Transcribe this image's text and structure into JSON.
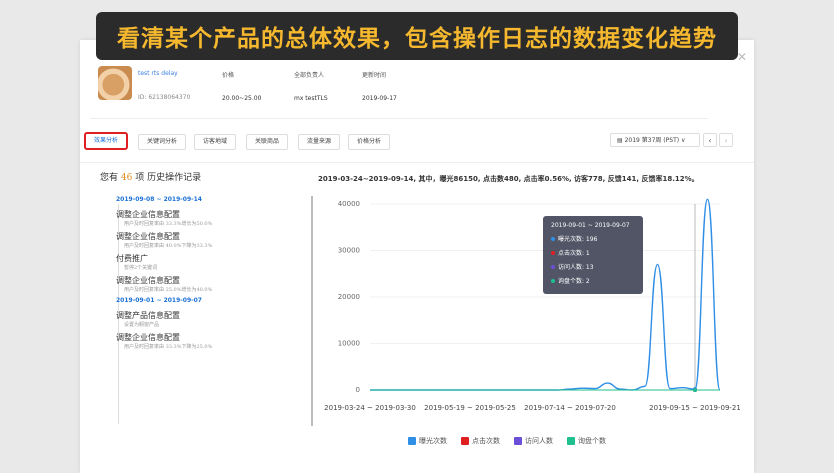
{
  "banner": "看清某个产品的总体效果，包含操作日志的数据变化趋势",
  "product": {
    "name": "test rts delay",
    "id": "ID: 62138064370",
    "price_label": "价格",
    "price": "20.00~25.00",
    "owner_label": "全部负责人",
    "owner": "mx testTLS",
    "updated_label": "更新时间",
    "updated": "2019-09-17"
  },
  "tabs": [
    "效果分析",
    "关键词分析",
    "访客地域",
    "关联商品",
    "流量来源",
    "价格分析"
  ],
  "week": "2019 第37周 (PST)",
  "log": {
    "title_pre": "您有",
    "count": "46",
    "title_post": "项 历史操作记录",
    "entries": [
      {
        "kind": "date",
        "text": "2019-09-08 ~ 2019-09-14"
      },
      {
        "kind": "op",
        "text": "调整企业信息配置",
        "sub": "用户及时回复率由 33.3%增长为50.0%"
      },
      {
        "kind": "op",
        "text": "调整企业信息配置",
        "sub": "用户及时回复率由 40.0%下降为33.3%"
      },
      {
        "kind": "op",
        "text": "付费推广",
        "sub": "暂停2个关键词"
      },
      {
        "kind": "op",
        "text": "调整企业信息配置",
        "sub": "用户及时回复率由 25.0%增长为40.0%"
      },
      {
        "kind": "date",
        "text": "2019-09-01 ~ 2019-09-07"
      },
      {
        "kind": "op",
        "text": "调整产品信息配置",
        "sub": "设置为橱窗产品"
      },
      {
        "kind": "op",
        "text": "调整企业信息配置",
        "sub": "用户及时回复率由 33.3%下降为25.0%"
      }
    ]
  },
  "summary": "2019-03-24~2019-09-14, 其中，曝光86150, 点击数480, 点击率0.56%, 访客778, 反馈141, 反馈率18.12%。",
  "tooltip": {
    "title": "2019-09-01 ~ 2019-09-07",
    "rows": [
      "曝光次数: 196",
      "点击次数: 1",
      "访问人数: 13",
      "询盘个数: 2"
    ]
  },
  "legend": [
    "曝光次数",
    "点击次数",
    "访问人数",
    "询盘个数"
  ],
  "colors": {
    "exposure": "#2f8ee6",
    "clicks": "#e02020",
    "visitors": "#6b4fd8",
    "inquiries": "#1fbf8f",
    "accent": "#1a6fd6"
  },
  "chart_data": {
    "type": "line",
    "x": [
      "2019-03-24 ~ 2019-03-30",
      "2019-05-19 ~ 2019-05-25",
      "2019-07-14 ~ 2019-07-20",
      "2019-09-15 ~ 2019-09-21"
    ],
    "ylim": [
      0,
      40000
    ],
    "yticks": [
      "0",
      "10000",
      "20000",
      "30000",
      "40000"
    ],
    "series": [
      {
        "name": "曝光次数",
        "values": [
          0,
          0,
          0,
          0,
          0,
          0,
          0,
          0,
          0,
          0,
          0,
          0,
          0,
          0,
          0,
          0,
          200,
          400,
          300,
          1500,
          200,
          0,
          800,
          27000,
          300,
          500,
          196,
          41000,
          0
        ]
      },
      {
        "name": "点击次数",
        "values": [
          0,
          0,
          0,
          0,
          0,
          0,
          0,
          0,
          0,
          0,
          0,
          0,
          0,
          0,
          0,
          0,
          0,
          0,
          0,
          0,
          0,
          0,
          0,
          0,
          0,
          0,
          1,
          0,
          0
        ]
      },
      {
        "name": "访问人数",
        "values": [
          0,
          0,
          0,
          0,
          0,
          0,
          0,
          0,
          0,
          0,
          0,
          0,
          0,
          0,
          0,
          0,
          0,
          0,
          0,
          0,
          0,
          0,
          0,
          0,
          0,
          0,
          13,
          0,
          0
        ]
      },
      {
        "name": "询盘个数",
        "values": [
          0,
          0,
          0,
          0,
          0,
          0,
          0,
          0,
          0,
          0,
          0,
          0,
          0,
          0,
          0,
          0,
          0,
          0,
          0,
          0,
          0,
          0,
          0,
          0,
          0,
          0,
          2,
          0,
          0
        ]
      }
    ]
  }
}
